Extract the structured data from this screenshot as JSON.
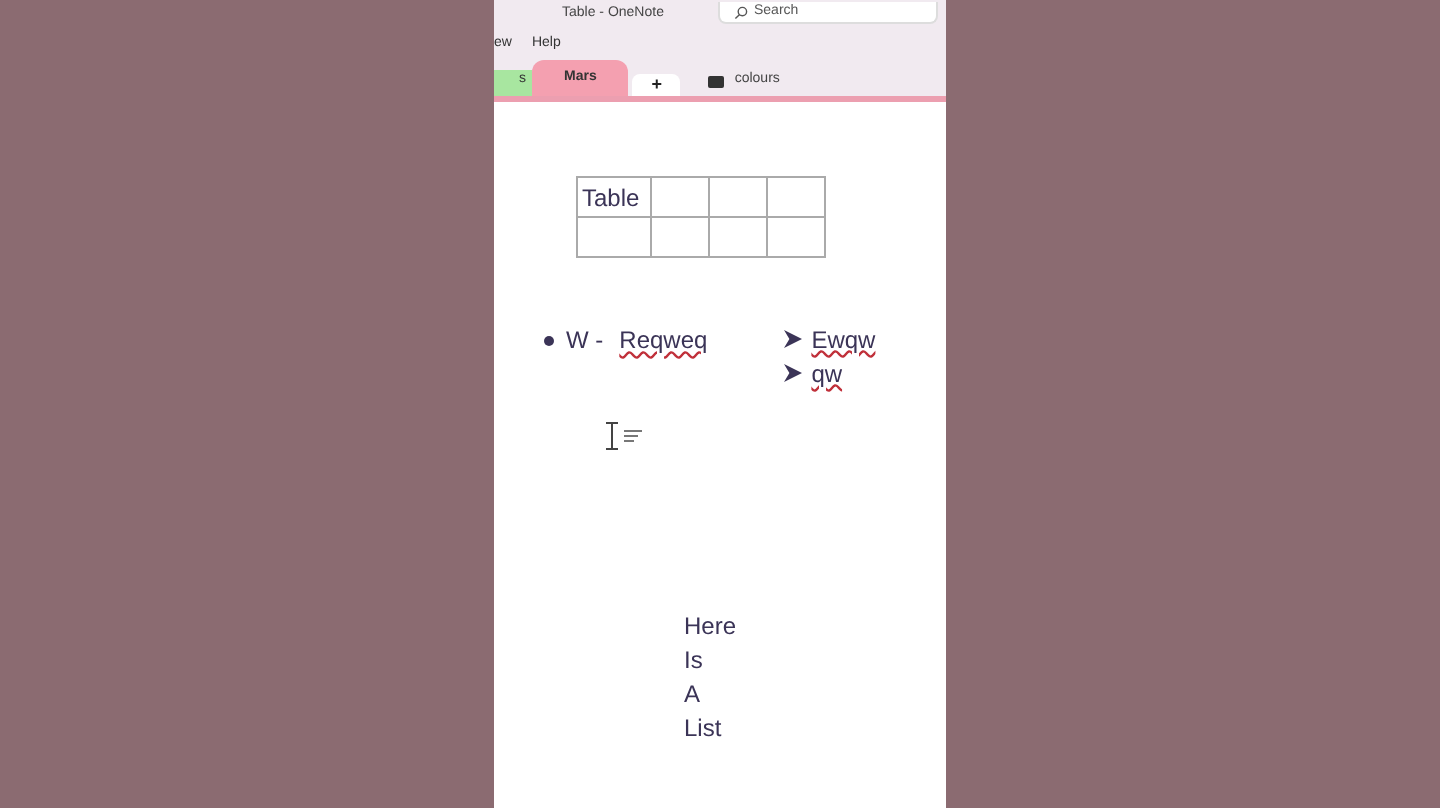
{
  "window": {
    "title": "Table - OneNote"
  },
  "search": {
    "placeholder": "Search"
  },
  "menu": [
    "ew",
    "Help"
  ],
  "section_tabs": [
    {
      "label": "s",
      "color": "#a8e6a0",
      "selected": false
    },
    {
      "label": "Mars",
      "color": "#f4a0b0",
      "selected": true
    }
  ],
  "add_tab": "+",
  "page_title": "colours",
  "table": {
    "rows": [
      [
        "Table",
        "",
        "",
        ""
      ],
      [
        "",
        "",
        "",
        ""
      ]
    ]
  },
  "bullet": {
    "prefix": "W -",
    "text": "Reqweq"
  },
  "sub_list": [
    "Ewqw",
    "qw"
  ],
  "list": [
    "Here",
    "Is",
    "A",
    "List"
  ]
}
